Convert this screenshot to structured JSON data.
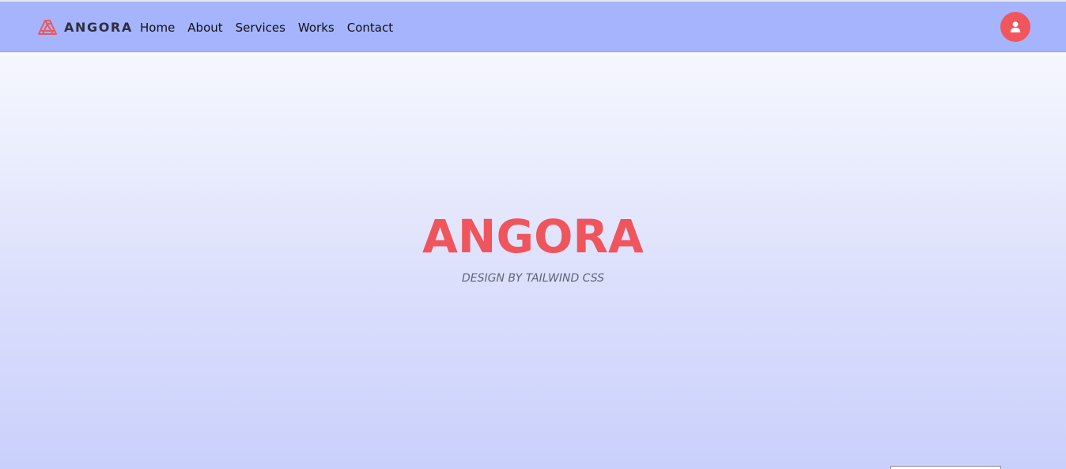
{
  "brand": {
    "name": "ANGORA",
    "logo_icon": "layered-triangle-logo-icon"
  },
  "nav": {
    "items": [
      {
        "label": "Home"
      },
      {
        "label": "About"
      },
      {
        "label": "Services"
      },
      {
        "label": "Works"
      },
      {
        "label": "Contact"
      }
    ]
  },
  "account": {
    "icon": "user-icon"
  },
  "hero": {
    "title": "ANGORA",
    "subtitle": "DESIGN BY TAILWIND CSS"
  },
  "colors": {
    "navbar_bg": "#a5b4fc",
    "accent": "#ef555c",
    "brand_text": "#2d2f3d",
    "subtitle_text": "#5f6478"
  }
}
